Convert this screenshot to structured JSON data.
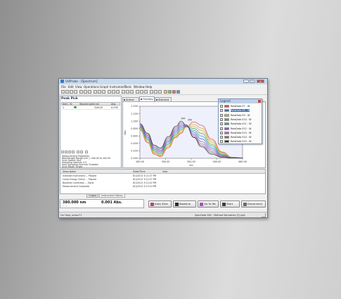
{
  "window": {
    "title": "UVProbe - [Spectrum]",
    "buttons": [
      "_",
      "□",
      "×"
    ]
  },
  "menu": [
    "File",
    "Edit",
    "View",
    "Operations",
    "Graph",
    "Instrument",
    "Tools",
    "Window",
    "Help"
  ],
  "peak_panel": {
    "title": "Peak Pick",
    "columns": [
      "Item",
      "ID",
      "Wavelength(nm)",
      "Abs."
    ],
    "row": {
      "item": "1",
      "wavelength": "318.00",
      "abs": "0.578"
    }
  },
  "properties": [
    "Measurement Properties",
    "Wavelength Range (nm.): 400.00 to 200.00",
    "Scan Speed: Fast",
    "Sampling Interval: 0.5",
    "Auto Sampling Interval: Enabled",
    "Scan Mode: Single"
  ],
  "graph_tabs": [
    "Active",
    "Overlay",
    "Stacked"
  ],
  "chart_data": {
    "type": "line",
    "title": "",
    "xlabel": "nm",
    "ylabel": "Abs.",
    "xlim": [
      260,
      460
    ],
    "ylim": [
      0,
      1.5
    ],
    "x_ticks": [
      "260.00",
      "300.00",
      "350.00",
      "400.00",
      "460.00"
    ],
    "y_ticks": [
      "0.000",
      "0.200",
      "0.400",
      "0.600",
      "0.800",
      "1.000",
      "1.200",
      "1.500"
    ],
    "annotations": [
      "344",
      "350"
    ],
    "series_colors": [
      "#d94c4c",
      "#e3a03a",
      "#c9c23c",
      "#5aa84f",
      "#3ca3a7",
      "#4b79c9",
      "#8a5bc4",
      "#c65bb3",
      "#7a7a7a",
      "#333333"
    ],
    "series": [
      {
        "values": [
          [
            260,
            0.82
          ],
          [
            275,
            0.45
          ],
          [
            288,
            0.12
          ],
          [
            300,
            0.05
          ],
          [
            315,
            0.3
          ],
          [
            330,
            0.6
          ],
          [
            340,
            0.72
          ],
          [
            350,
            0.9
          ],
          [
            365,
            1.05
          ],
          [
            380,
            0.95
          ],
          [
            400,
            0.55
          ],
          [
            420,
            0.18
          ],
          [
            440,
            0.03
          ],
          [
            460,
            0.01
          ]
        ]
      },
      {
        "values": [
          [
            260,
            0.84
          ],
          [
            275,
            0.48
          ],
          [
            288,
            0.15
          ],
          [
            300,
            0.07
          ],
          [
            315,
            0.33
          ],
          [
            330,
            0.62
          ],
          [
            340,
            0.75
          ],
          [
            350,
            0.9
          ],
          [
            365,
            0.98
          ],
          [
            380,
            0.87
          ],
          [
            400,
            0.5
          ],
          [
            420,
            0.16
          ],
          [
            440,
            0.03
          ],
          [
            460,
            0.01
          ]
        ]
      },
      {
        "values": [
          [
            260,
            0.86
          ],
          [
            275,
            0.51
          ],
          [
            288,
            0.17
          ],
          [
            300,
            0.09
          ],
          [
            315,
            0.36
          ],
          [
            330,
            0.65
          ],
          [
            340,
            0.79
          ],
          [
            350,
            0.9
          ],
          [
            365,
            0.92
          ],
          [
            380,
            0.8
          ],
          [
            400,
            0.45
          ],
          [
            420,
            0.14
          ],
          [
            440,
            0.03
          ],
          [
            460,
            0.01
          ]
        ]
      },
      {
        "values": [
          [
            260,
            0.88
          ],
          [
            275,
            0.54
          ],
          [
            288,
            0.2
          ],
          [
            300,
            0.12
          ],
          [
            315,
            0.4
          ],
          [
            330,
            0.68
          ],
          [
            340,
            0.83
          ],
          [
            350,
            0.91
          ],
          [
            365,
            0.86
          ],
          [
            380,
            0.72
          ],
          [
            400,
            0.4
          ],
          [
            420,
            0.12
          ],
          [
            440,
            0.02
          ],
          [
            460,
            0.01
          ]
        ]
      },
      {
        "values": [
          [
            260,
            0.9
          ],
          [
            275,
            0.57
          ],
          [
            288,
            0.23
          ],
          [
            300,
            0.15
          ],
          [
            315,
            0.43
          ],
          [
            330,
            0.72
          ],
          [
            340,
            0.87
          ],
          [
            350,
            0.91
          ],
          [
            365,
            0.8
          ],
          [
            380,
            0.64
          ],
          [
            400,
            0.35
          ],
          [
            420,
            0.1
          ],
          [
            440,
            0.02
          ],
          [
            460,
            0.01
          ]
        ]
      },
      {
        "values": [
          [
            260,
            0.92
          ],
          [
            275,
            0.6
          ],
          [
            288,
            0.26
          ],
          [
            300,
            0.18
          ],
          [
            315,
            0.47
          ],
          [
            330,
            0.76
          ],
          [
            340,
            0.91
          ],
          [
            350,
            0.92
          ],
          [
            365,
            0.75
          ],
          [
            380,
            0.56
          ],
          [
            400,
            0.3
          ],
          [
            420,
            0.08
          ],
          [
            440,
            0.02
          ],
          [
            460,
            0.01
          ]
        ]
      },
      {
        "values": [
          [
            260,
            0.94
          ],
          [
            275,
            0.63
          ],
          [
            288,
            0.29
          ],
          [
            300,
            0.21
          ],
          [
            315,
            0.5
          ],
          [
            330,
            0.8
          ],
          [
            340,
            0.95
          ],
          [
            350,
            0.92
          ],
          [
            365,
            0.7
          ],
          [
            380,
            0.48
          ],
          [
            400,
            0.25
          ],
          [
            420,
            0.07
          ],
          [
            440,
            0.02
          ],
          [
            460,
            0.01
          ]
        ]
      },
      {
        "values": [
          [
            260,
            0.96
          ],
          [
            275,
            0.66
          ],
          [
            288,
            0.32
          ],
          [
            300,
            0.24
          ],
          [
            315,
            0.54
          ],
          [
            330,
            0.84
          ],
          [
            340,
            0.99
          ],
          [
            350,
            0.93
          ],
          [
            365,
            0.66
          ],
          [
            380,
            0.42
          ],
          [
            400,
            0.2
          ],
          [
            420,
            0.05
          ],
          [
            440,
            0.01
          ],
          [
            460,
            0.01
          ]
        ]
      },
      {
        "values": [
          [
            260,
            0.98
          ],
          [
            275,
            0.69
          ],
          [
            288,
            0.35
          ],
          [
            300,
            0.27
          ],
          [
            315,
            0.58
          ],
          [
            330,
            0.88
          ],
          [
            340,
            1.03
          ],
          [
            350,
            0.94
          ],
          [
            365,
            0.62
          ],
          [
            380,
            0.37
          ],
          [
            400,
            0.16
          ],
          [
            420,
            0.04
          ],
          [
            440,
            0.01
          ],
          [
            460,
            0.01
          ]
        ]
      },
      {
        "values": [
          [
            260,
            1.0
          ],
          [
            275,
            0.72
          ],
          [
            288,
            0.38
          ],
          [
            300,
            0.3
          ],
          [
            315,
            0.62
          ],
          [
            330,
            0.92
          ],
          [
            340,
            1.07
          ],
          [
            350,
            0.96
          ],
          [
            365,
            0.6
          ],
          [
            380,
            0.33
          ],
          [
            400,
            0.12
          ],
          [
            420,
            0.03
          ],
          [
            440,
            0.01
          ],
          [
            460,
            0.01
          ]
        ]
      }
    ]
  },
  "legend": {
    "title": "Legend",
    "items": [
      {
        "label": "RawData 07 - W",
        "color": "#d94c4c",
        "selected": false
      },
      {
        "label": "RawData 08 - W",
        "color": "#3a6fb5",
        "selected": true
      },
      {
        "label": "RawData 09 - W",
        "color": "#e3a03a",
        "selected": false
      },
      {
        "label": "RawData 010 - W",
        "color": "#5aa84f",
        "selected": false
      },
      {
        "label": "RawData 011 - W",
        "color": "#3ca3a7",
        "selected": false
      },
      {
        "label": "RawData 012 - W",
        "color": "#8a5bc4",
        "selected": false
      },
      {
        "label": "RawData 013 - W",
        "color": "#c65bb3",
        "selected": false
      },
      {
        "label": "RawData 014 - W",
        "color": "#7a7a7a",
        "selected": false
      },
      {
        "label": "RawData 015 - W",
        "color": "#333333",
        "selected": false
      }
    ]
  },
  "log": {
    "columns": [
      "Description",
      "Date/Time",
      "User"
    ],
    "rows": [
      {
        "desc": "Initialize Instrument ... Passed",
        "time": "8/1/2013 3:11:37 PM"
      },
      {
        "desc": "Lamp Energy Check ... Passed",
        "time": "8/1/2013 3:12:37 PM"
      },
      {
        "desc": "Baseline Correction ... Done",
        "time": "8/1/2013 3:12:42 PM"
      },
      {
        "desc": "Measurement Complete",
        "time": "8/1/2013 3:13:10 PM"
      }
    ]
  },
  "bottom_tabs": [
    "Output",
    "Instrument History"
  ],
  "readout": {
    "wavelength": "380.000 nm",
    "abs": "0.001 Abs.",
    "sub": "← →"
  },
  "actions": [
    "Auto Zero",
    "Baseline",
    "Go To WL",
    "Start",
    "Disconnect"
  ],
  "status": {
    "left": "For Help, press F1",
    "right": "SpecData 962 - Method Saturation [2].spk"
  }
}
